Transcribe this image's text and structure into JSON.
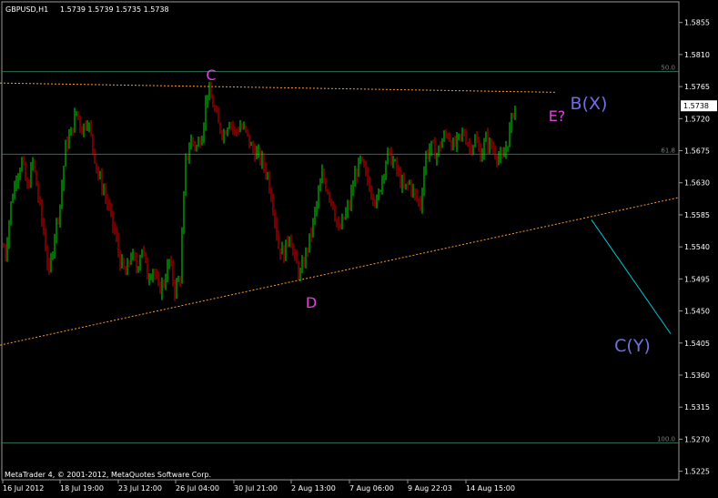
{
  "header": {
    "symbol": "GBPUSD,H1",
    "ohlc": "1.5739 1.5739 1.5735 1.5738"
  },
  "footer": {
    "copyright": "MetaTrader 4, © 2001-2012, MetaQuotes Software Corp."
  },
  "colors": {
    "background": "#000000",
    "bull": "#00e000",
    "bear": "#e00000",
    "label_magenta": "#e040e0",
    "label_violet": "#7070e0",
    "trendline": "#ff9933",
    "arrow": "#00c8d8",
    "level": "#2f6f5f"
  },
  "chart_data": {
    "type": "candlestick",
    "title": "GBPUSD,H1",
    "y_ticks": [
      "1.5855",
      "1.5810",
      "1.5765",
      "1.5720",
      "1.5675",
      "1.5630",
      "1.5585",
      "1.5540",
      "1.5495",
      "1.5450",
      "1.5405",
      "1.5360",
      "1.5315",
      "1.5270",
      "1.5225"
    ],
    "ylim": [
      1.5213,
      1.5884
    ],
    "x_ticks": [
      "16 Jul 2012",
      "18 Jul 19:00",
      "23 Jul 12:00",
      "26 Jul 04:00",
      "30 Jul 21:00",
      "2 Aug 13:00",
      "7 Aug 06:00",
      "9 Aug 22:03",
      "14 Aug 15:00"
    ],
    "current_price": "1.5738",
    "fib_levels": [
      {
        "label": "50.0",
        "price": 1.5786
      },
      {
        "label": "61.8",
        "price": 1.567
      },
      {
        "label": "100.0",
        "price": 1.5265
      }
    ],
    "wave_labels": [
      "C",
      "D",
      "E?",
      "B(X)",
      "C(Y)"
    ],
    "price_path": [
      [
        0,
        1.556
      ],
      [
        6,
        1.553
      ],
      [
        12,
        1.56
      ],
      [
        18,
        1.564
      ],
      [
        24,
        1.566
      ],
      [
        30,
        1.562
      ],
      [
        36,
        1.566
      ],
      [
        42,
        1.561
      ],
      [
        48,
        1.556
      ],
      [
        54,
        1.55
      ],
      [
        60,
        1.556
      ],
      [
        66,
        1.56
      ],
      [
        72,
        1.568
      ],
      [
        78,
        1.57
      ],
      [
        84,
        1.573
      ],
      [
        90,
        1.5705
      ],
      [
        96,
        1.572
      ],
      [
        102,
        1.568
      ],
      [
        108,
        1.564
      ],
      [
        114,
        1.562
      ],
      [
        120,
        1.559
      ],
      [
        126,
        1.556
      ],
      [
        132,
        1.552
      ],
      [
        138,
        1.55
      ],
      [
        144,
        1.553
      ],
      [
        150,
        1.551
      ],
      [
        156,
        1.554
      ],
      [
        162,
        1.55
      ],
      [
        168,
        1.551
      ],
      [
        174,
        1.548
      ],
      [
        180,
        1.549
      ],
      [
        186,
        1.552
      ],
      [
        192,
        1.548
      ],
      [
        198,
        1.55
      ],
      [
        204,
        1.566
      ],
      [
        210,
        1.569
      ],
      [
        216,
        1.568
      ],
      [
        222,
        1.57
      ],
      [
        228,
        1.576
      ],
      [
        234,
        1.574
      ],
      [
        240,
        1.571
      ],
      [
        246,
        1.57
      ],
      [
        252,
        1.572
      ],
      [
        258,
        1.57
      ],
      [
        264,
        1.571
      ],
      [
        270,
        1.57
      ],
      [
        276,
        1.568
      ],
      [
        282,
        1.567
      ],
      [
        288,
        1.566
      ],
      [
        294,
        1.564
      ],
      [
        300,
        1.56
      ],
      [
        306,
        1.554
      ],
      [
        312,
        1.553
      ],
      [
        318,
        1.556
      ],
      [
        324,
        1.552
      ],
      [
        330,
        1.55
      ],
      [
        336,
        1.553
      ],
      [
        342,
        1.556
      ],
      [
        348,
        1.56
      ],
      [
        354,
        1.564
      ],
      [
        360,
        1.562
      ],
      [
        366,
        1.56
      ],
      [
        372,
        1.556
      ],
      [
        378,
        1.558
      ],
      [
        384,
        1.56
      ],
      [
        390,
        1.564
      ],
      [
        396,
        1.566
      ],
      [
        402,
        1.564
      ],
      [
        408,
        1.562
      ],
      [
        414,
        1.56
      ],
      [
        420,
        1.564
      ],
      [
        426,
        1.567
      ],
      [
        432,
        1.566
      ],
      [
        438,
        1.564
      ],
      [
        444,
        1.562
      ],
      [
        450,
        1.563
      ],
      [
        456,
        1.561
      ],
      [
        462,
        1.56
      ],
      [
        468,
        1.567
      ],
      [
        474,
        1.568
      ],
      [
        480,
        1.567
      ],
      [
        486,
        1.569
      ],
      [
        492,
        1.57
      ],
      [
        498,
        1.568
      ],
      [
        504,
        1.569
      ],
      [
        510,
        1.57
      ],
      [
        516,
        1.568
      ],
      [
        522,
        1.569
      ],
      [
        528,
        1.567
      ],
      [
        534,
        1.569
      ],
      [
        540,
        1.568
      ],
      [
        546,
        1.567
      ],
      [
        552,
        1.566
      ],
      [
        558,
        1.569
      ],
      [
        564,
        1.573
      ],
      [
        566,
        1.5738
      ]
    ],
    "trendlines": [
      {
        "name": "upper-dotted",
        "x": [
          0,
          610
        ],
        "y": [
          1.577,
          1.5757
        ]
      },
      {
        "name": "lower-dotted",
        "x": [
          0,
          745
        ],
        "y": [
          1.5402,
          1.5609
        ]
      }
    ],
    "arrow_line": {
      "x": [
        650,
        737
      ],
      "y": [
        1.5578,
        1.5418
      ]
    }
  }
}
